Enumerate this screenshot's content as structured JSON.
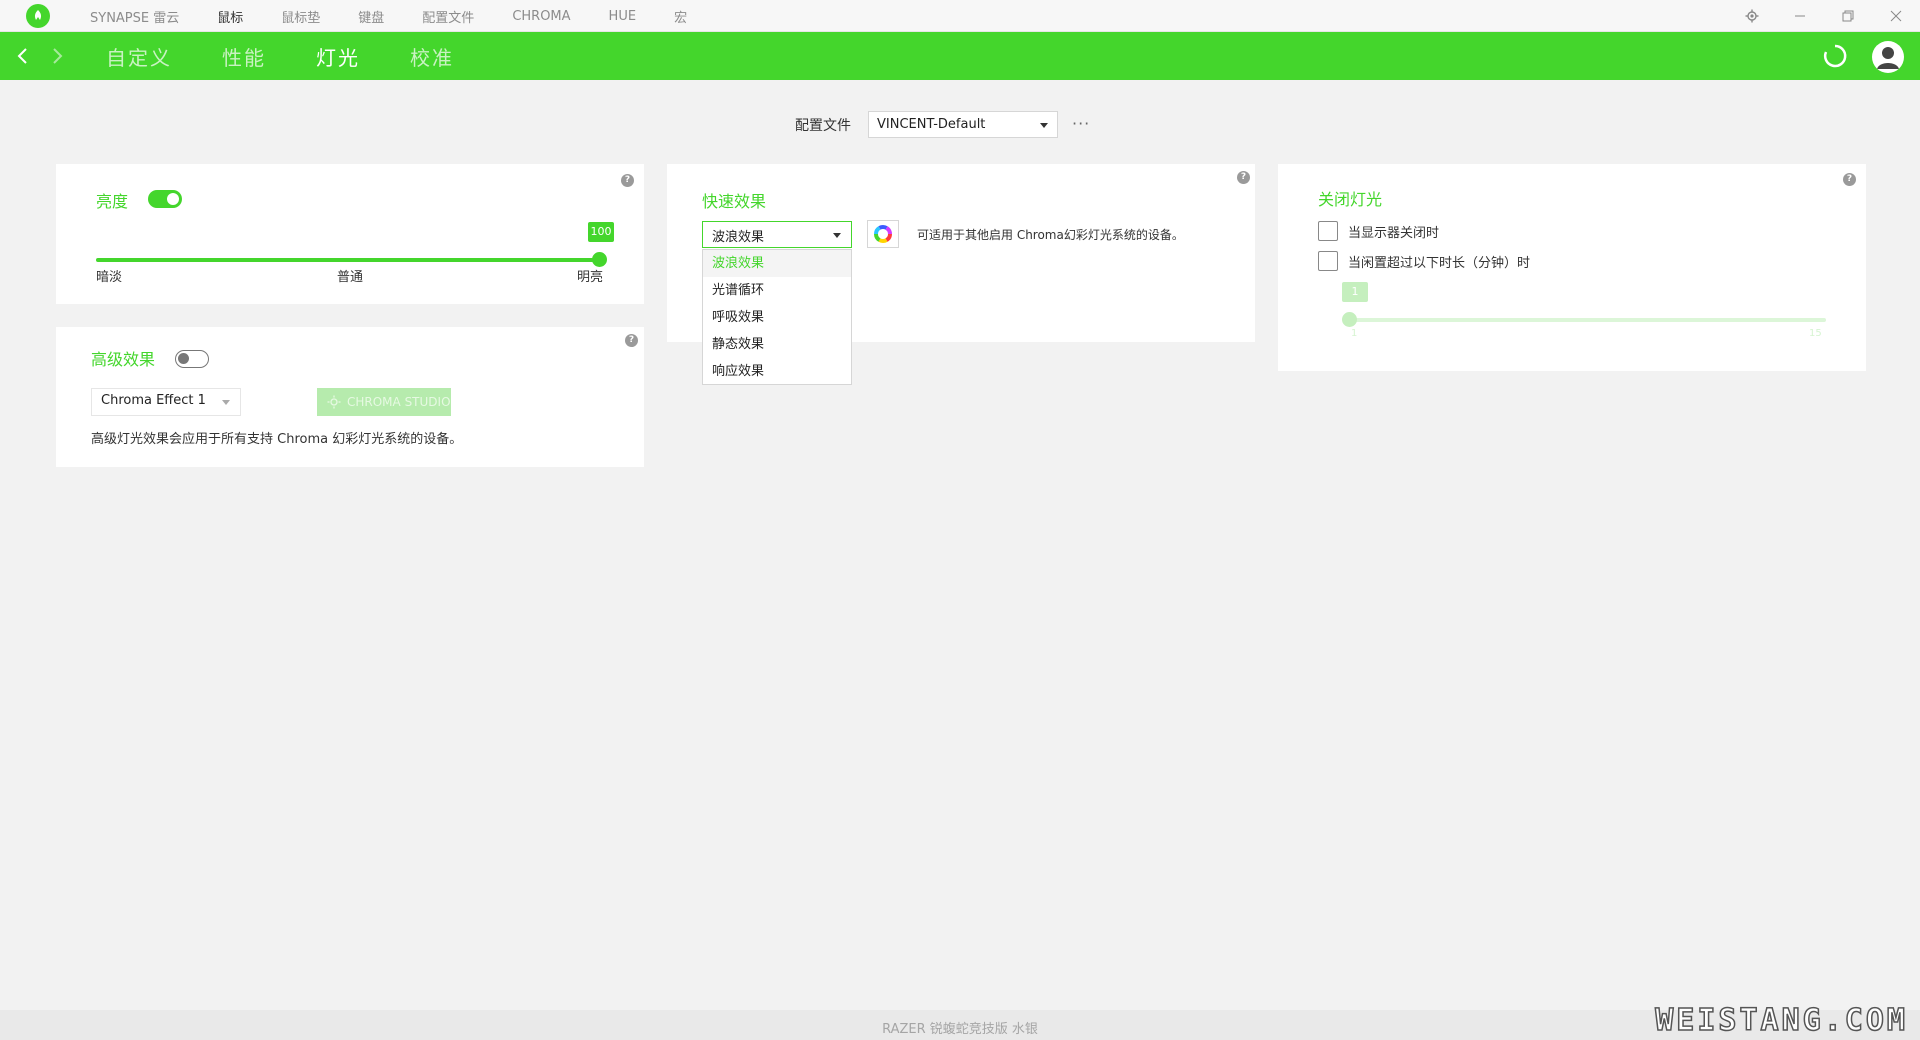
{
  "topbar": {
    "nav": [
      "SYNAPSE 雷云",
      "鼠标",
      "鼠标垫",
      "键盘",
      "配置文件",
      "CHROMA",
      "HUE",
      "宏"
    ],
    "active_index": 1
  },
  "greenbar": {
    "tabs": [
      "自定义",
      "性能",
      "灯光",
      "校准"
    ],
    "active_index": 2
  },
  "profile": {
    "label": "配置文件",
    "value": "VINCENT-Default",
    "more": "···"
  },
  "brightness": {
    "title": "亮度",
    "enabled": true,
    "value": "100",
    "level_fraction": 1.0,
    "labels": [
      "暗淡",
      "普通",
      "明亮"
    ]
  },
  "advanced": {
    "title": "高级效果",
    "enabled": false,
    "effect_value": "Chroma Effect 1",
    "studio_label": "CHROMA STUDIO",
    "description": "高级灯光效果会应用于所有支持 Chroma 幻彩灯光系统的设备。"
  },
  "quick": {
    "title": "快速效果",
    "selected": "波浪效果",
    "hint": "可适用于其他启用 Chroma幻彩灯光系统的设备。",
    "options": [
      "波浪效果",
      "光谱循环",
      "呼吸效果",
      "静态效果",
      "响应效果"
    ]
  },
  "lights_off": {
    "title": "关闭灯光",
    "opt1": "当显示器关闭时",
    "opt2": "当闲置超过以下时长（分钟）时",
    "value": "1",
    "min": "1",
    "max": "15"
  },
  "footer": {
    "text": "RAZER 锐蝮蛇竞技版 水银",
    "watermark": "WEISTANG.COM"
  },
  "colors": {
    "accent": "#44d62c",
    "background": "#f2f2f2"
  }
}
